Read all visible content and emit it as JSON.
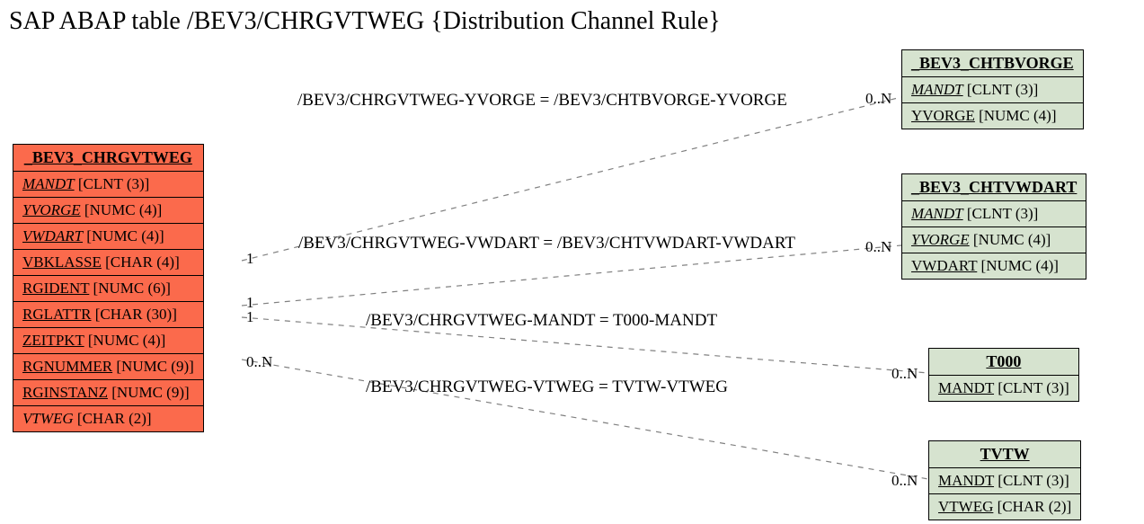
{
  "title": "SAP ABAP table /BEV3/CHRGVTWEG {Distribution Channel Rule}",
  "main_table": {
    "header": "_BEV3_CHRGVTWEG",
    "fields": [
      {
        "name": "MANDT",
        "type": "[CLNT (3)]",
        "key": true,
        "italic": true
      },
      {
        "name": "YVORGE",
        "type": "[NUMC (4)]",
        "key": true,
        "italic": true
      },
      {
        "name": "VWDART",
        "type": "[NUMC (4)]",
        "key": true,
        "italic": true
      },
      {
        "name": "VBKLASSE",
        "type": "[CHAR (4)]",
        "key": true,
        "italic": false
      },
      {
        "name": "RGIDENT",
        "type": "[NUMC (6)]",
        "key": true,
        "italic": false
      },
      {
        "name": "RGLATTR",
        "type": "[CHAR (30)]",
        "key": true,
        "italic": false
      },
      {
        "name": "ZEITPKT",
        "type": "[NUMC (4)]",
        "key": true,
        "italic": false
      },
      {
        "name": "RGNUMMER",
        "type": "[NUMC (9)]",
        "key": true,
        "italic": false
      },
      {
        "name": "RGINSTANZ",
        "type": "[NUMC (9)]",
        "key": true,
        "italic": false
      },
      {
        "name": "VTWEG",
        "type": "[CHAR (2)]",
        "key": false,
        "italic": true
      }
    ]
  },
  "ref_tables": {
    "chtbvorge": {
      "header": "_BEV3_CHTBVORGE",
      "fields": [
        {
          "name": "MANDT",
          "type": "[CLNT (3)]",
          "key": true,
          "italic": true
        },
        {
          "name": "YVORGE",
          "type": "[NUMC (4)]",
          "key": true,
          "italic": false
        }
      ]
    },
    "chtvwdart": {
      "header": "_BEV3_CHTVWDART",
      "fields": [
        {
          "name": "MANDT",
          "type": "[CLNT (3)]",
          "key": true,
          "italic": true
        },
        {
          "name": "YVORGE",
          "type": "[NUMC (4)]",
          "key": true,
          "italic": true
        },
        {
          "name": "VWDART",
          "type": "[NUMC (4)]",
          "key": true,
          "italic": false
        }
      ]
    },
    "t000": {
      "header": "T000",
      "fields": [
        {
          "name": "MANDT",
          "type": "[CLNT (3)]",
          "key": true,
          "italic": false
        }
      ]
    },
    "tvtw": {
      "header": "TVTW",
      "fields": [
        {
          "name": "MANDT",
          "type": "[CLNT (3)]",
          "key": true,
          "italic": false
        },
        {
          "name": "VTWEG",
          "type": "[CHAR (2)]",
          "key": true,
          "italic": false
        }
      ]
    }
  },
  "relations": {
    "r1": {
      "label": "/BEV3/CHRGVTWEG-YVORGE = /BEV3/CHTBVORGE-YVORGE",
      "card_left": "1",
      "card_right": "0..N"
    },
    "r2": {
      "label": "/BEV3/CHRGVTWEG-VWDART = /BEV3/CHTVWDART-VWDART",
      "card_left": "1",
      "card_right": "0..N"
    },
    "r3": {
      "label": "/BEV3/CHRGVTWEG-MANDT = T000-MANDT",
      "card_left": "1",
      "card_right": "0..N"
    },
    "r4": {
      "label": "/BEV3/CHRGVTWEG-VTWEG = TVTW-VTWEG",
      "card_left": "0..N",
      "card_right": "0..N"
    }
  }
}
